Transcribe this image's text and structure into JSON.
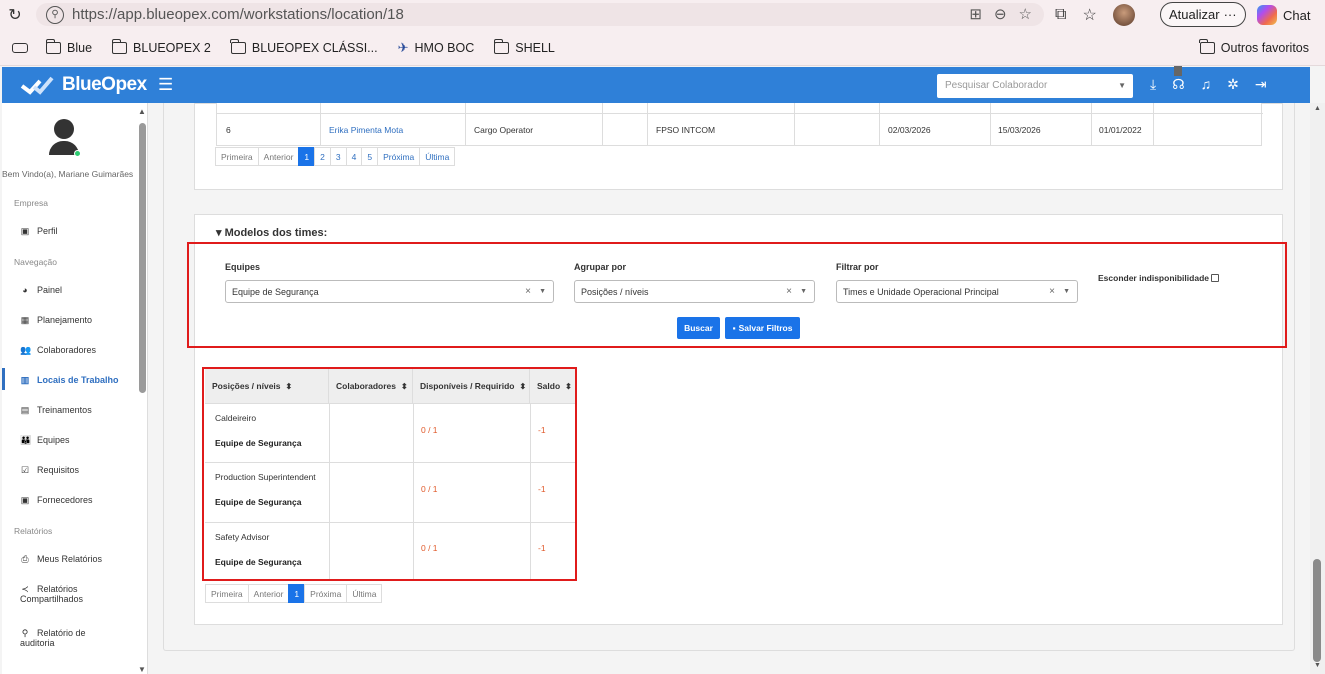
{
  "browser": {
    "url": "https://app.blueopex.com/workstations/location/18",
    "update_label": "Atualizar",
    "chat_label": "Chat",
    "bookmarks": [
      "Blue",
      "BLUEOPEX 2",
      "BLUEOPEX CLÁSSI...",
      "HMO BOC",
      "SHELL"
    ],
    "other_favorites": "Outros favoritos"
  },
  "app": {
    "brand": "BlueOpex",
    "search_placeholder": "Pesquisar Colaborador"
  },
  "sidebar": {
    "welcome": "Bem Vindo(a), Mariane Guimarães",
    "section_empresa": "Empresa",
    "section_navegacao": "Navegação",
    "section_relatorios": "Relatórios",
    "items": {
      "perfil": "Perfil",
      "painel": "Painel",
      "planejamento": "Planejamento",
      "colaboradores": "Colaboradores",
      "locais": "Locais de Trabalho",
      "treinamentos": "Treinamentos",
      "equipes": "Equipes",
      "requisitos": "Requisitos",
      "fornecedores": "Fornecedores",
      "meus_relatorios": "Meus Relatórios",
      "rel_comp_1": "Relatórios",
      "rel_comp_2": "Compartilhados",
      "rel_aud_1": "Relatório de",
      "rel_aud_2": "auditoria"
    }
  },
  "top_table": {
    "row": {
      "num": "6",
      "name": "Erika Pimenta Mota",
      "role": "Cargo Operator",
      "unit": "FPSO INTCOM",
      "date1": "02/03/2026",
      "date2": "15/03/2026",
      "date3": "01/01/2022"
    },
    "pager": {
      "first": "Primeira",
      "prev": "Anterior",
      "pages": [
        "1",
        "2",
        "3",
        "4",
        "5"
      ],
      "next": "Próxima",
      "last": "Última"
    }
  },
  "modelos": {
    "title": "▾ Modelos dos times:",
    "equipes_label": "Equipes",
    "equipes_value": "Equipe de Segurança",
    "agrupar_label": "Agrupar por",
    "agrupar_value": "Posições / níveis",
    "filtrar_label": "Filtrar por",
    "filtrar_value": "Times e Unidade Operacional Principal",
    "esconder_label": "Esconder indisponibilidade",
    "buscar": "Buscar",
    "salvar": "Salvar Filtros"
  },
  "results": {
    "headers": [
      "Posições / níveis",
      "Colaboradores",
      "Disponíveis / Requirido",
      "Saldo"
    ],
    "rows": [
      {
        "position": "Caldeireiro",
        "team": "Equipe de Segurança",
        "ratio": "0 / 1",
        "saldo": "-1"
      },
      {
        "position": "Production Superintendent",
        "team": "Equipe de Segurança",
        "ratio": "0 / 1",
        "saldo": "-1"
      },
      {
        "position": "Safety Advisor",
        "team": "Equipe de Segurança",
        "ratio": "0 / 1",
        "saldo": "-1"
      }
    ],
    "pager": {
      "first": "Primeira",
      "prev": "Anterior",
      "page": "1",
      "next": "Próxima",
      "last": "Última"
    }
  }
}
